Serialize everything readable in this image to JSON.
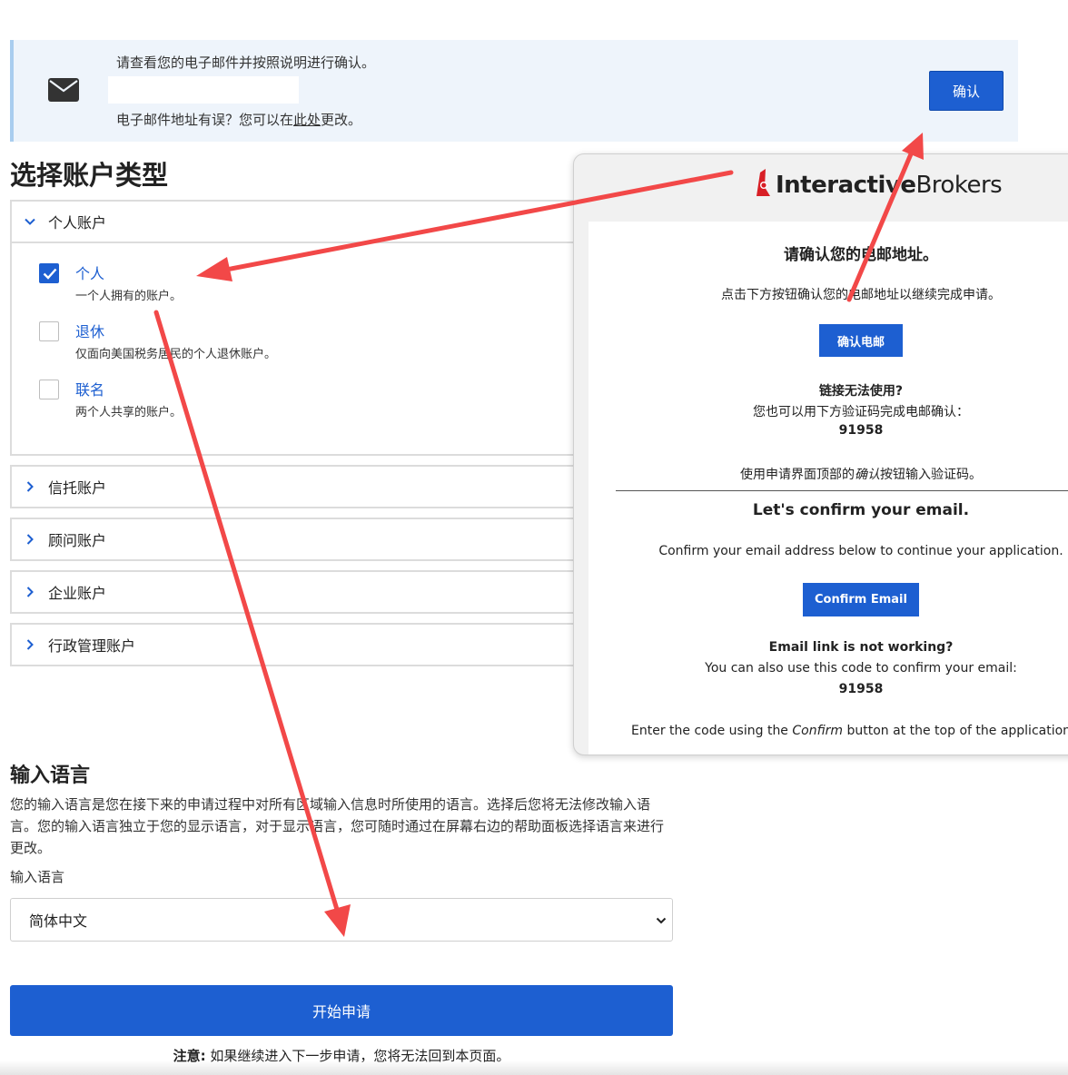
{
  "banner": {
    "line1": "请查看您的电子邮件并按照说明进行确认。",
    "line2_prefix": "电子邮件地址有误？您可以在",
    "line2_link": "此处",
    "line2_suffix": "更改。",
    "confirm_label": "确认",
    "icon": "envelope-icon"
  },
  "account_section": {
    "title": "选择账户类型",
    "groups": [
      {
        "label": "个人账户",
        "expanded": true,
        "options": [
          {
            "title": "个人",
            "desc": "一个人拥有的账户。",
            "checked": true
          },
          {
            "title": "退休",
            "desc": "仅面向美国税务居民的个人退休账户。",
            "checked": false
          },
          {
            "title": "联名",
            "desc": "两个人共享的账户。",
            "checked": false
          }
        ]
      },
      {
        "label": "信托账户",
        "expanded": false
      },
      {
        "label": "顾问账户",
        "expanded": false
      },
      {
        "label": "企业账户",
        "expanded": false
      },
      {
        "label": "行政管理账户",
        "expanded": false
      }
    ]
  },
  "language_section": {
    "title": "输入语言",
    "description": "您的输入语言是您在接下来的申请过程中对所有区域输入信息时所使用的语言。选择后您将无法修改输入语言。您的输入语言独立于您的显示语言，对于显示语言，您可随时通过在屏幕右边的帮助面板选择语言来进行更改。",
    "field_label": "输入语言",
    "selected": "简体中文",
    "start_button": "开始申请",
    "note_bold": "注意:",
    "note_text": " 如果继续进入下一步申请，您将无法回到本页面。"
  },
  "email_preview": {
    "logo_bold": "Interactive",
    "logo_light": "Brokers",
    "cn_heading": "请确认您的电邮地址。",
    "cn_instruction": "点击下方按钮确认您的电邮地址以继续完成申请。",
    "cn_button": "确认电邮",
    "cn_link_title": "链接无法使用?",
    "cn_code_hint": "您也可以用下方验证码完成电邮确认：",
    "cn_code": "91958",
    "cn_footer_prefix": "使用申请界面顶部的",
    "cn_footer_em": "确认",
    "cn_footer_suffix": "按钮输入验证码。",
    "en_heading": "Let's confirm your email.",
    "en_instruction": "Confirm your email address below to continue your application.",
    "en_button": "Confirm Email",
    "en_link_title": "Email link is not working?",
    "en_code_hint": "You can also use this code to confirm your email:",
    "en_code": "91958",
    "en_footer_prefix": "Enter the code using the ",
    "en_footer_em": "Confirm",
    "en_footer_suffix": " button at the top of the application pa"
  },
  "colors": {
    "primary_blue": "#1d5fd1",
    "banner_bg": "#eef4fb",
    "annotation_red": "#f24848"
  }
}
